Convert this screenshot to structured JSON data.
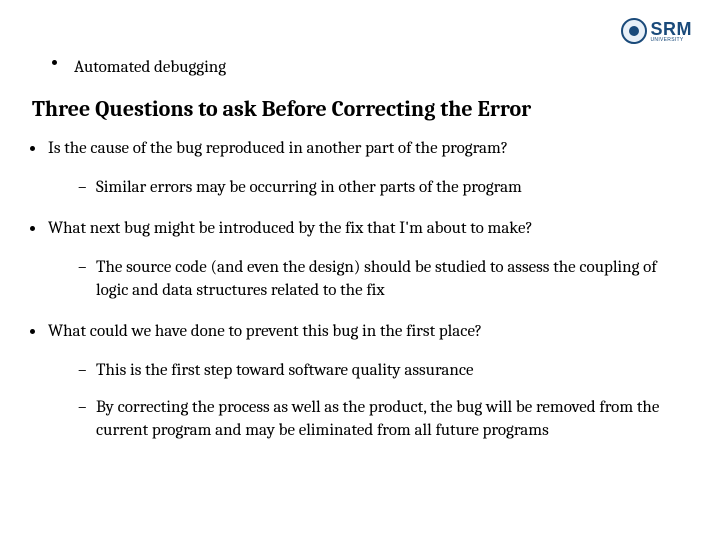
{
  "logo": {
    "brand": "SRM",
    "sub": "UNIVERSITY"
  },
  "topline": "Automated debugging",
  "heading": "Three Questions to ask Before Correcting the Error",
  "q1": {
    "question": "Is the cause of the bug reproduced in another part of the program?",
    "sub1": "Similar errors may be occurring in other parts of the program"
  },
  "q2": {
    "question": "What next bug might be introduced by the fix that I'm about to make?",
    "sub1": "The source code (and even the design) should be studied to assess the coupling of logic and data structures related to the fix"
  },
  "q3": {
    "question": "What could we have done to prevent this bug in the first place?",
    "sub1": "This is the first step toward software quality assurance",
    "sub2": "By correcting the process as well as the product, the bug will be removed from the current program and may be eliminated from all future programs"
  }
}
